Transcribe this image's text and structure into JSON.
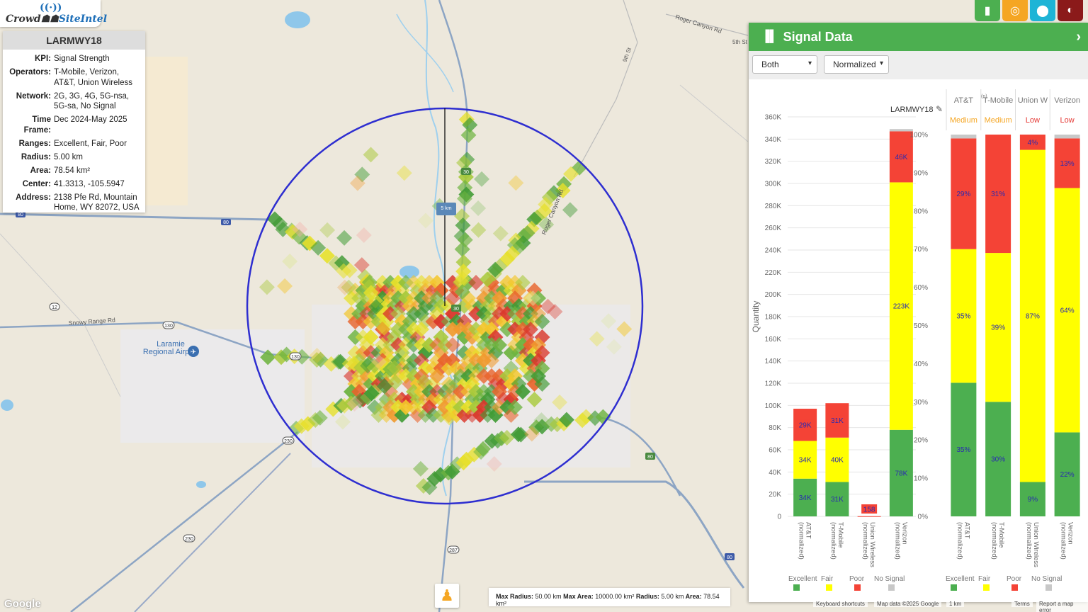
{
  "logo": {
    "part1": "Crowd",
    "part2": "SiteIntel"
  },
  "info": {
    "site": "LARMWY18",
    "rows": [
      {
        "k": "KPI:",
        "v": "Signal Strength"
      },
      {
        "k": "Operators:",
        "v": "T-Mobile, Verizon, AT&T, Union Wireless"
      },
      {
        "k": "Network:",
        "v": "2G, 3G, 4G, 5G-nsa, 5G-sa, No Signal"
      },
      {
        "k": "Time Frame:",
        "v": "Dec 2024-May 2025"
      },
      {
        "k": "Ranges:",
        "v": "Excellent, Fair, Poor"
      },
      {
        "k": "Radius:",
        "v": "5.00 km"
      },
      {
        "k": "Area:",
        "v": "78.54 km²"
      },
      {
        "k": "Center:",
        "v": "41.3313, -105.5947"
      },
      {
        "k": "Address:",
        "v": "2138 Pfe Rd, Mountain Home, WY 82072, USA"
      }
    ]
  },
  "map": {
    "labels": {
      "roger1": "Roger Canyon Rd",
      "roger2": "Roger Canyon Rd",
      "ninth": "9th St",
      "snowy": "Snowy Range Rd",
      "airport": "Laramie Regional Airport",
      "fifthst": "5th St",
      "scale": "5 km"
    },
    "shields": [
      "80",
      "80",
      "12",
      "130",
      "230",
      "230",
      "287",
      "80",
      "80",
      "30",
      "30",
      "130"
    ]
  },
  "controls": {
    "icons": [
      "bar-chart-icon",
      "target-icon",
      "pin-icon",
      "globe-icon"
    ],
    "colors": [
      "#4caf50",
      "#f5a623",
      "#1eb4d6",
      "#8b1a1a"
    ]
  },
  "panel": {
    "title": "Signal Data",
    "select1": "Both",
    "select2": "Normalized",
    "chart_title": "LARMWY18"
  },
  "bottom_bar": {
    "maxr_k": "Max Radius:",
    "maxr_v": "50.00 km",
    "maxa_k": "Max Area:",
    "maxa_v": "10000.00 km²",
    "r_k": "Radius:",
    "r_v": "5.00 km",
    "a_k": "Area:",
    "a_v": "78.54 km²"
  },
  "attribution": {
    "google": "Google",
    "keyboard": "Keyboard shortcuts",
    "mapdata": "Map data ©2025 Google",
    "scale": "1 km",
    "terms": "Terms",
    "report": "Report a map error"
  },
  "chart_data": [
    {
      "type": "bar",
      "stacked": true,
      "title": "",
      "ylabel": "Quantity",
      "ylim": [
        0,
        360000
      ],
      "yticks": [
        "0",
        "20K",
        "40K",
        "60K",
        "80K",
        "100K",
        "120K",
        "140K",
        "160K",
        "180K",
        "200K",
        "220K",
        "240K",
        "260K",
        "280K",
        "300K",
        "320K",
        "340K",
        "360K"
      ],
      "categories": [
        "AT&T (normalized)",
        "T-Mobile (normalized)",
        "Union Wireless (normalized)",
        "Verizon (normalized)"
      ],
      "series": [
        {
          "name": "Excellent",
          "values": [
            34000,
            31000,
            0,
            78000
          ],
          "labels": [
            "34K",
            "31K",
            "",
            "78K"
          ]
        },
        {
          "name": "Fair",
          "values": [
            34000,
            40000,
            0,
            223000
          ],
          "labels": [
            "34K",
            "40K",
            "",
            "223K"
          ]
        },
        {
          "name": "Poor",
          "values": [
            29000,
            31000,
            158,
            46000
          ],
          "labels": [
            "29K",
            "31K",
            "158",
            "46K"
          ]
        },
        {
          "name": "No Signal",
          "values": [
            0,
            0,
            0,
            2000
          ],
          "labels": [
            "",
            "",
            "",
            ""
          ]
        }
      ],
      "colors": {
        "Excellent": "#4caf50",
        "Fair": "#ffff00",
        "Poor": "#f44336",
        "No Signal": "#c8c8c8"
      },
      "legend": "bottom"
    },
    {
      "type": "bar",
      "stacked": true,
      "title": "",
      "ylim": [
        0,
        100
      ],
      "yticks": [
        "0%",
        "10%",
        "20%",
        "30%",
        "40%",
        "50%",
        "60%",
        "70%",
        "80%",
        "90%",
        "100%"
      ],
      "categories": [
        "AT&T (normalized)",
        "T-Mobile (normalized)",
        "Union Wireless (normalized)",
        "Verizon (normalized)"
      ],
      "headers": [
        "AT&T",
        "T-Mobile",
        "Union W",
        "Verizon"
      ],
      "ratings": [
        "Medium",
        "Medium",
        "Low",
        "Low"
      ],
      "rating_colors": [
        "#f5a623",
        "#f5a623",
        "#e53935",
        "#e53935"
      ],
      "series": [
        {
          "name": "Excellent",
          "values": [
            35,
            30,
            9,
            22
          ],
          "labels": [
            "35%",
            "30%",
            "9%",
            "22%"
          ]
        },
        {
          "name": "Fair",
          "values": [
            35,
            39,
            87,
            64
          ],
          "labels": [
            "35%",
            "39%",
            "87%",
            "64%"
          ]
        },
        {
          "name": "Poor",
          "values": [
            29,
            31,
            4,
            13
          ],
          "labels": [
            "29%",
            "31%",
            "4%",
            "13%"
          ]
        },
        {
          "name": "No Signal",
          "values": [
            1,
            0,
            0,
            1
          ],
          "labels": [
            "",
            "",
            "",
            ""
          ]
        }
      ],
      "colors": {
        "Excellent": "#4caf50",
        "Fair": "#ffff00",
        "Poor": "#f44336",
        "No Signal": "#c8c8c8"
      },
      "legend": "bottom"
    }
  ]
}
